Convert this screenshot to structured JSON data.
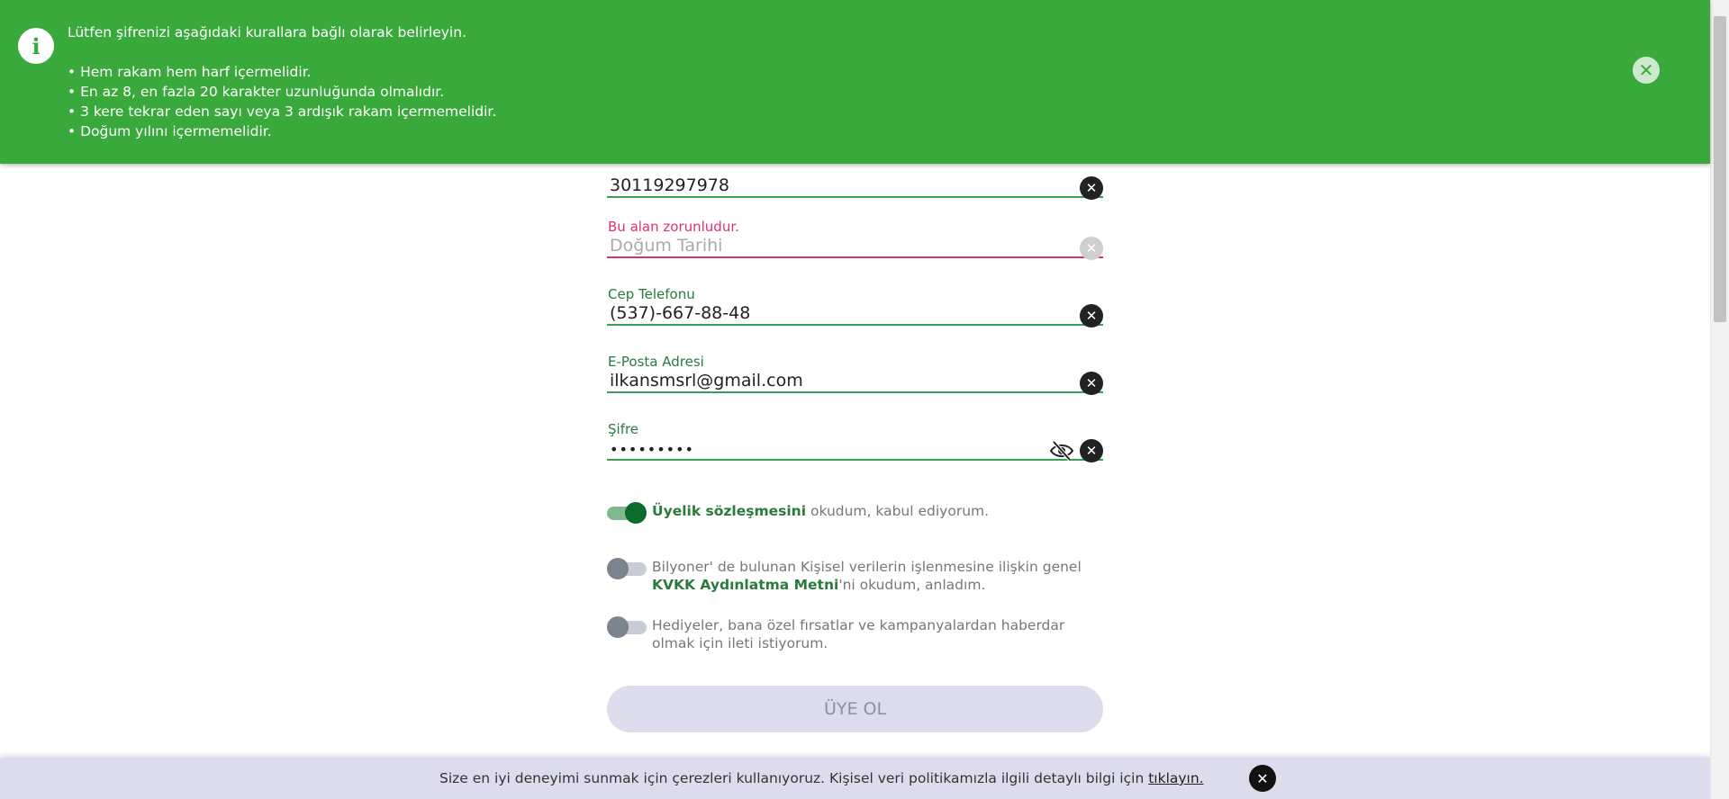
{
  "notification": {
    "title": "Lütfen şifrenizi aşağıdaki kurallara bağlı olarak belirleyin.",
    "rules": [
      "• Hem rakam hem harf içermelidir.",
      "• En az 8, en fazla 20 karakter uzunluğunda olmalıdır.",
      "• 3 kere tekrar eden sayı veya 3 ardışık rakam içermemelidir.",
      "• Doğum yılını içermemelidir."
    ],
    "info_glyph": "i",
    "close_glyph": "✕",
    "color": "#3aa93c"
  },
  "form": {
    "tc": {
      "value": "30119297978"
    },
    "birth": {
      "error": "Bu alan zorunludur.",
      "placeholder": "Doğum Tarihi"
    },
    "phone": {
      "label": "Cep Telefonu",
      "value": "(537)-667-88-48"
    },
    "email": {
      "label": "E-Posta Adresi",
      "value": "ilkansmsrl@gmail.com"
    },
    "password": {
      "label": "Şifre",
      "value": "•••••••••"
    },
    "clear_glyph": "✕"
  },
  "toggles": {
    "membership": {
      "link": "Üyelik sözleşmesini",
      "text": " okudum, kabul ediyorum.",
      "on": true
    },
    "kvkk": {
      "prefix": "Bilyoner' de bulunan Kişisel verilerin işlenmesine ilişkin genel ",
      "link": "KVKK Aydınlatma Metni",
      "suffix": "'ni okudum, anladım.",
      "on": false
    },
    "campaign": {
      "text": "Hediyeler, bana özel fırsatlar ve kampanyalardan haberdar olmak için ileti istiyorum.",
      "on": false
    }
  },
  "submit": {
    "label": "ÜYE OL"
  },
  "cookie": {
    "text": "Size en iyi deneyimi sunmak için çerezleri kullanıyoruz. Kişisel veri politikamızla ilgili detaylı bilgi için ",
    "link": "tıklayın.",
    "close_glyph": "✕"
  }
}
